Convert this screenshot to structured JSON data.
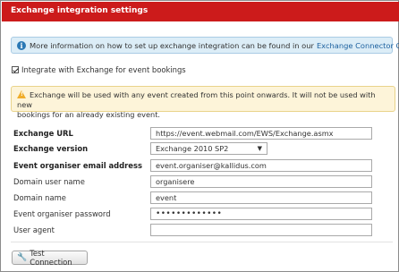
{
  "header": {
    "title": "Exchange integration settings"
  },
  "info": {
    "icon": "info-icon",
    "text": "More information on how to set up exchange integration can be found in our",
    "link_text": "Exchange Connector Guide"
  },
  "integrate_checkbox": {
    "checked": true,
    "label": "Integrate with Exchange for event bookings"
  },
  "warning": {
    "icon": "warning-icon",
    "line1": "Exchange will be used with any event created from this point onwards. It will not be used with new",
    "line2": "bookings for an already existing event."
  },
  "form": {
    "exchange_url": {
      "label": "Exchange URL",
      "value": "https://event.webmail.com/EWS/Exchange.asmx"
    },
    "exchange_version": {
      "label": "Exchange version",
      "value": "Exchange 2010 SP2"
    },
    "organiser_email": {
      "label": "Event organiser email address",
      "value": "event.organiser@kallidus.com"
    },
    "domain_user_name": {
      "label": "Domain user name",
      "value": "organisere"
    },
    "domain_name": {
      "label": "Domain name",
      "value": "event"
    },
    "organiser_password": {
      "label": "Event organiser password",
      "value": "•••••••••••••"
    },
    "user_agent": {
      "label": "User agent",
      "value": ""
    }
  },
  "test_button": {
    "label": "Test Connection",
    "icon": "wrench-icon"
  },
  "colors": {
    "header": "#cc1b1b",
    "info_bg": "#dcedf7",
    "warning_bg": "#fdf4d9",
    "link": "#1a5f9e"
  }
}
